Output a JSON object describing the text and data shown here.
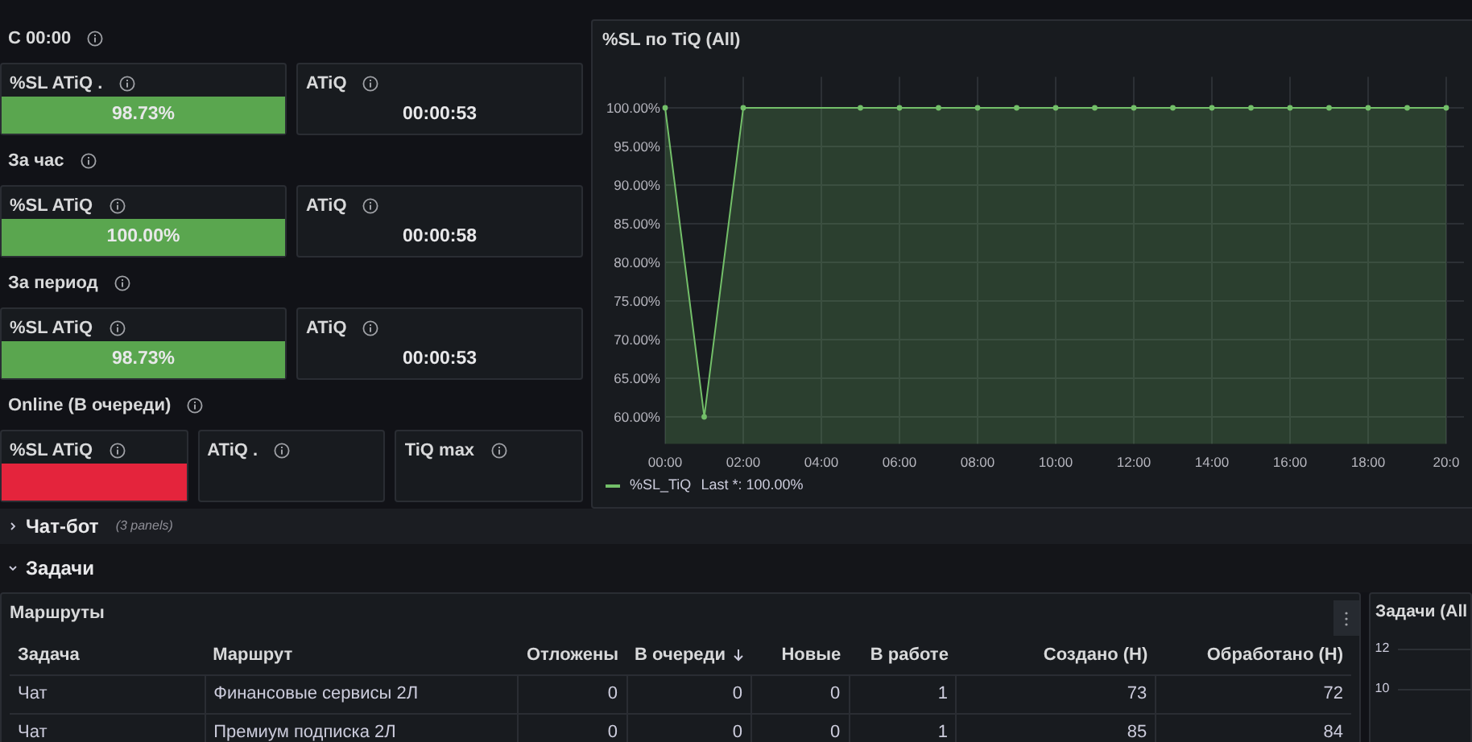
{
  "overview": {
    "groups": [
      {
        "label": "С 00:00",
        "panels": [
          {
            "title": "%SL ATiQ .",
            "value": "98.73%",
            "color": "#5aa64f"
          },
          {
            "title": "ATiQ",
            "value": "00:00:53"
          }
        ]
      },
      {
        "label": "За час",
        "panels": [
          {
            "title": "%SL ATiQ",
            "value": "100.00%",
            "color": "#5aa64f"
          },
          {
            "title": "ATiQ",
            "value": "00:00:58"
          }
        ]
      },
      {
        "label": "За период",
        "panels": [
          {
            "title": "%SL ATiQ",
            "value": "98.73%",
            "color": "#5aa64f"
          },
          {
            "title": "ATiQ",
            "value": "00:00:53"
          }
        ]
      },
      {
        "label": "Online (В очереди)",
        "panels": [
          {
            "title": "%SL ATiQ",
            "color": "#e4243c"
          },
          {
            "title": "ATiQ ."
          },
          {
            "title": "TiQ max"
          }
        ]
      }
    ]
  },
  "sl_chart": {
    "title": "%SL по TiQ (All)",
    "legend_stat": "Last *: 100.00%",
    "chart_data": {
      "type": "area",
      "x": [
        0,
        1,
        2,
        3,
        4,
        5,
        6,
        7,
        8,
        9,
        10,
        11,
        12,
        13,
        14,
        15,
        16,
        17,
        18,
        19,
        20
      ],
      "series": [
        {
          "name": "%SL_TiQ",
          "color": "#73bf69",
          "values": [
            100,
            60,
            100,
            null,
            null,
            100,
            100,
            100,
            100,
            100,
            100,
            100,
            100,
            100,
            100,
            100,
            100,
            100,
            100,
            100,
            100
          ]
        }
      ],
      "xticks": [
        {
          "value": 0,
          "label": "00:00"
        },
        {
          "value": 2,
          "label": "02:00"
        },
        {
          "value": 4,
          "label": "04:00"
        },
        {
          "value": 6,
          "label": "06:00"
        },
        {
          "value": 8,
          "label": "08:00"
        },
        {
          "value": 10,
          "label": "10:00"
        },
        {
          "value": 12,
          "label": "12:00"
        },
        {
          "value": 14,
          "label": "14:00"
        },
        {
          "value": 16,
          "label": "16:00"
        },
        {
          "value": 18,
          "label": "18:00"
        },
        {
          "value": 20,
          "label": "20:0"
        }
      ],
      "yticks": [
        {
          "value": 60,
          "label": "60.00%"
        },
        {
          "value": 65,
          "label": "65.00%"
        },
        {
          "value": 70,
          "label": "70.00%"
        },
        {
          "value": 75,
          "label": "75.00%"
        },
        {
          "value": 80,
          "label": "80.00%"
        },
        {
          "value": 85,
          "label": "85.00%"
        },
        {
          "value": 90,
          "label": "90.00%"
        },
        {
          "value": 95,
          "label": "95.00%"
        },
        {
          "value": 100,
          "label": "100.00%"
        }
      ],
      "ylim": [
        56.5,
        104
      ],
      "xlim": [
        0,
        20
      ],
      "grid": true
    }
  },
  "rows": [
    {
      "title": "Чат-бот",
      "count": "(3 panels)",
      "expanded": false
    },
    {
      "title": "Задачи",
      "expanded": true
    }
  ],
  "routes_table": {
    "title": "Маршруты",
    "columns": [
      {
        "label": "Задача",
        "kind": "text"
      },
      {
        "label": "Маршрут",
        "kind": "text"
      },
      {
        "label": "Отложены",
        "kind": "number"
      },
      {
        "label": "В очереди",
        "kind": "number",
        "sorted_descending": true
      },
      {
        "label": "Новые",
        "kind": "number"
      },
      {
        "label": "В работе",
        "kind": "number"
      },
      {
        "label": "Создано (Н)",
        "kind": "number"
      },
      {
        "label": "Обработано (Н)",
        "kind": "number"
      }
    ],
    "rows": [
      [
        "Чат",
        "Финансовые сервисы 2Л",
        "0",
        "0",
        "0",
        "1",
        "73",
        "72"
      ],
      [
        "Чат",
        "Премиум подписка 2Л",
        "0",
        "0",
        "0",
        "1",
        "85",
        "84"
      ]
    ]
  },
  "tasks_panel": {
    "title": "Задачи (All",
    "y_tick_labels": [
      "12",
      "10"
    ]
  }
}
